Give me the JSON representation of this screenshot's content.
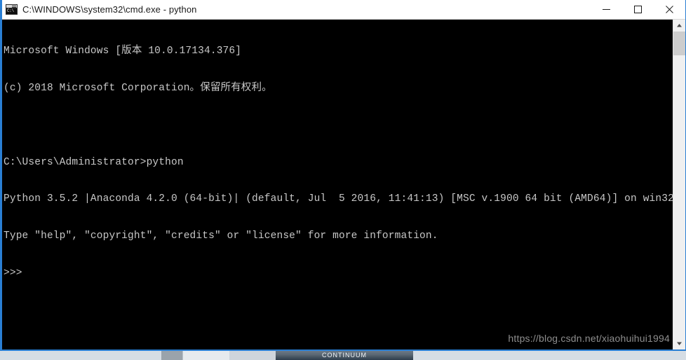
{
  "window": {
    "title": "C:\\WINDOWS\\system32\\cmd.exe - python",
    "icon": "cmd-console-icon",
    "icon_glyph": "C:\\",
    "border_color": "#2a7fd4",
    "titlebar_bg": "#ffffff",
    "titlebar_fg": "#1a1a1a"
  },
  "controls": {
    "minimize_name": "minimize-button",
    "maximize_name": "maximize-button",
    "close_name": "close-button"
  },
  "console": {
    "background": "#000000",
    "foreground": "#c8c8c8",
    "lines": [
      "Microsoft Windows [版本 10.0.17134.376]",
      "(c) 2018 Microsoft Corporation。保留所有权利。",
      "",
      "C:\\Users\\Administrator>python",
      "Python 3.5.2 |Anaconda 4.2.0 (64-bit)| (default, Jul  5 2016, 11:41:13) [MSC v.1900 64 bit (AMD64)] on win32",
      "Type \"help\", \"copyright\", \"credits\" or \"license\" for more information.",
      ">>>"
    ]
  },
  "watermark": {
    "text": "https://blog.csdn.net/xiaohuihui1994",
    "color": "#8e8e8e"
  },
  "scrollbar": {
    "up_arrow": "scroll-up-arrow",
    "down_arrow": "scroll-down-arrow",
    "thumb": "scroll-thumb"
  },
  "taskbar": {
    "items": [
      {
        "label": "",
        "name": "taskbar-item-1"
      },
      {
        "label": "",
        "name": "taskbar-item-2"
      },
      {
        "label": "",
        "name": "taskbar-item-3"
      },
      {
        "label": "CONTINUUM",
        "name": "taskbar-item-continuum"
      }
    ]
  }
}
